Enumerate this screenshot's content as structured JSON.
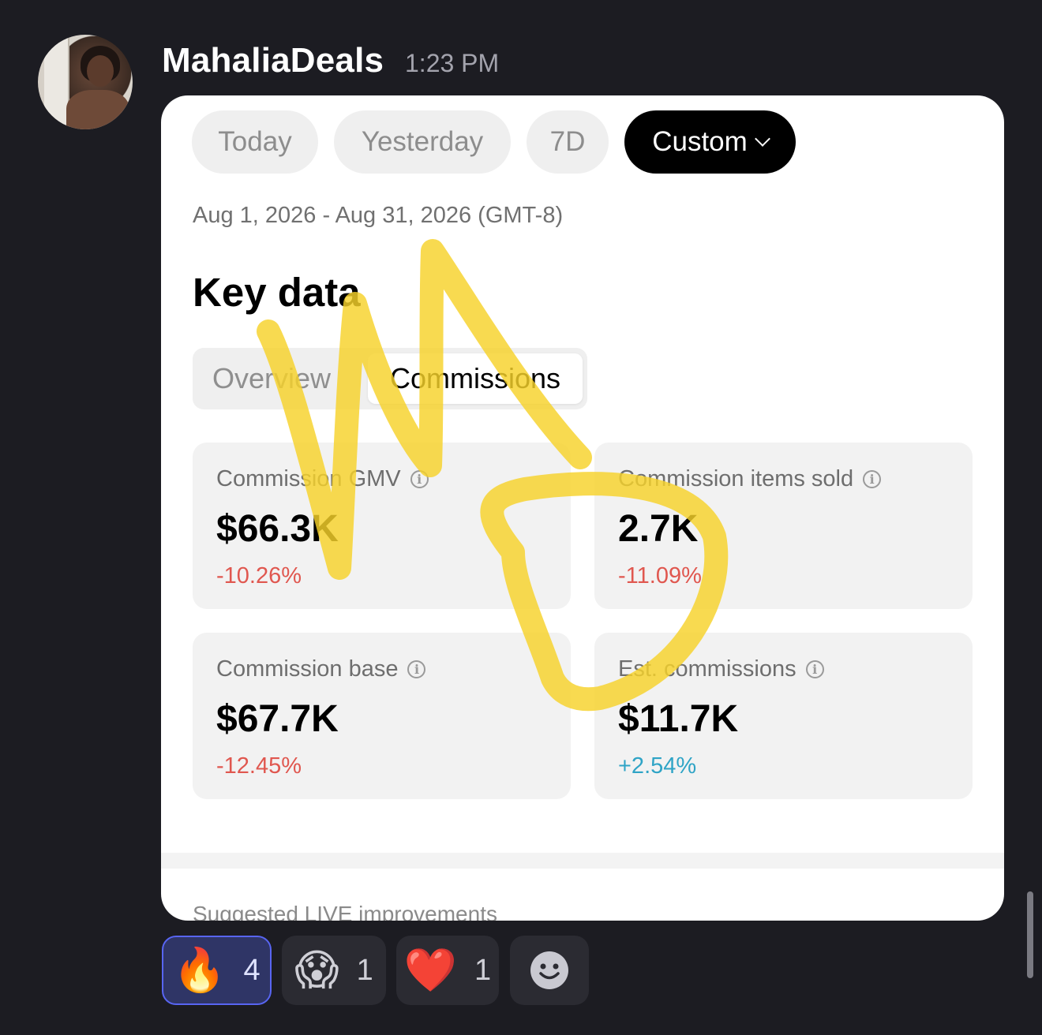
{
  "message": {
    "username": "MahaliaDeals",
    "timestamp": "1:23 PM"
  },
  "card": {
    "date_tabs": [
      "Today",
      "Yesterday",
      "7D",
      "Custom"
    ],
    "active_tab": "Custom",
    "date_range": "Aug 1, 2026 - Aug 31, 2026 (GMT-8)",
    "section_title": "Key data",
    "segments": [
      "Overview",
      "Commissions"
    ],
    "active_segment": "Commissions",
    "metrics": [
      {
        "label": "Commission GMV",
        "value": "$66.3K",
        "delta": "-10.26%",
        "trend": "down"
      },
      {
        "label": "Commission items sold",
        "value": "2.7K",
        "delta": "-11.09%",
        "trend": "down"
      },
      {
        "label": "Commission base",
        "value": "$67.7K",
        "delta": "-12.45%",
        "trend": "down"
      },
      {
        "label": "Est. commissions",
        "value": "$11.7K",
        "delta": "+2.54%",
        "trend": "up"
      }
    ],
    "next_section": "Suggested LIVE improvements"
  },
  "reactions": [
    {
      "emoji": "🔥",
      "count": "4",
      "active": true
    },
    {
      "emoji": "😱",
      "count": "1",
      "active": false
    },
    {
      "emoji": "❤️",
      "count": "1",
      "active": false
    }
  ],
  "colors": {
    "background": "#1c1c22",
    "negative": "#e0574f",
    "positive": "#2fa4c6",
    "highlighter": "#f6d22a",
    "reaction_active_border": "#5865f2"
  },
  "icons": [
    "info-icon",
    "chevron-down-icon",
    "add-reaction-icon"
  ]
}
